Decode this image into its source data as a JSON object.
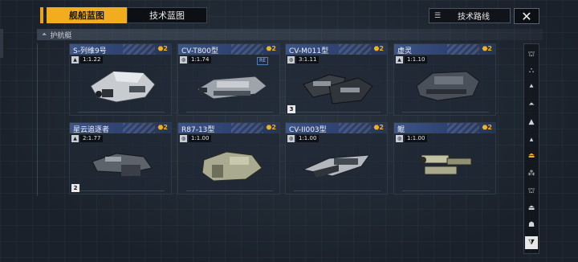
{
  "tabs": [
    {
      "label": "舰船蓝图",
      "active": true
    },
    {
      "label": "技术蓝图",
      "active": false
    }
  ],
  "roadmap_button": {
    "label": "技术路线",
    "icon": "roadmap-icon"
  },
  "close_button": {
    "label": "✕"
  },
  "category": {
    "label": "护航艇",
    "icon": "ship-category-icon"
  },
  "accent_color": "#f2ad1f",
  "cards": [
    {
      "name": "S-列维9号",
      "badge": "⬣2",
      "scale_icon": "ship-icon",
      "scale": "1:1.22",
      "count": ""
    },
    {
      "name": "CV-T800型",
      "badge": "⬣2",
      "scale_icon": "globe-icon",
      "scale": "1:1.74",
      "re": "RE",
      "count": ""
    },
    {
      "name": "CV-M011型",
      "badge": "⬣2",
      "scale_icon": "globe-icon",
      "scale": "3:1.11",
      "count": "3"
    },
    {
      "name": "虚灵",
      "badge": "⬣2",
      "scale_icon": "ship-icon",
      "scale": "1:1.10",
      "count": ""
    },
    {
      "name": "星云追逐者",
      "badge": "⬣2",
      "scale_icon": "ship-icon",
      "scale": "2:1.77",
      "count": "2"
    },
    {
      "name": "R87-13型",
      "badge": "⬣2",
      "scale_icon": "globe-icon",
      "scale": "1:1.00",
      "count": ""
    },
    {
      "name": "CV-II003型",
      "badge": "⬣2",
      "scale_icon": "globe-icon",
      "scale": "1:1.00",
      "count": ""
    },
    {
      "name": "鲲",
      "badge": "⬣2",
      "scale_icon": "globe-icon",
      "scale": "1:1.00",
      "count": ""
    }
  ],
  "rail_icons": [
    "carrier-icon",
    "battleship-icon",
    "cruiser-icon",
    "destroyer-icon",
    "frigate-icon",
    "corvette-icon",
    "escort-icon",
    "fighter-icon",
    "station-icon",
    "auxiliary-icon",
    "special-icon",
    "filter-icon"
  ]
}
